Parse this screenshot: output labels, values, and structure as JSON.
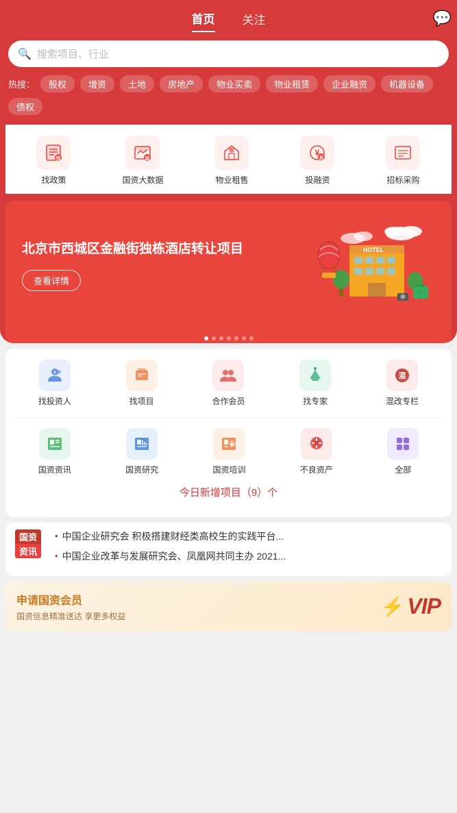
{
  "header": {
    "tab_home": "首页",
    "tab_follow": "关注",
    "message_icon": "💬"
  },
  "search": {
    "placeholder": "搜索项目、行业",
    "icon": "🔍"
  },
  "hot_search": {
    "label": "热搜：",
    "tags": [
      "股权",
      "增资",
      "土地",
      "房地产",
      "物业买卖",
      "物业租赁",
      "企业融资",
      "机器设备",
      "债权"
    ]
  },
  "quick_menu": [
    {
      "icon": "📋",
      "label": "找政策"
    },
    {
      "icon": "🏛️",
      "label": "国资大数据"
    },
    {
      "icon": "🏠",
      "label": "物业租售"
    },
    {
      "icon": "💰",
      "label": "投融资"
    },
    {
      "icon": "📑",
      "label": "招标采购"
    }
  ],
  "banner": {
    "title": "北京市西城区金融街独栋酒店转让项目",
    "btn": "查看详情",
    "dots": 7,
    "active_dot": 0
  },
  "sec_menu": [
    {
      "icon": "👤",
      "label": "找投资人",
      "color": "blue"
    },
    {
      "icon": "📁",
      "label": "找项目",
      "color": "orange"
    },
    {
      "icon": "🤝",
      "label": "合作会员",
      "color": "red"
    },
    {
      "icon": "🎓",
      "label": "找专家",
      "color": "teal"
    },
    {
      "icon": "🔖",
      "label": "混改专栏",
      "color": "crimson"
    }
  ],
  "third_menu": [
    {
      "icon": "📰",
      "label": "国资资讯",
      "color": "green"
    },
    {
      "icon": "📊",
      "label": "国资研究",
      "color": "blue2"
    },
    {
      "icon": "🎯",
      "label": "国资培训",
      "color": "orange2"
    },
    {
      "icon": "⚠️",
      "label": "不良资产",
      "color": "red2"
    },
    {
      "icon": "⚙️",
      "label": "全部",
      "color": "purple"
    }
  ],
  "today_new": {
    "text": "今日新增项目（9）个"
  },
  "news": [
    {
      "badge_top": "国资",
      "badge_bottom": "资讯",
      "items": [
        "• 中国企业研究会 积极搭建财经类高校生的实践平台...",
        "• 中国企业改革与发展研究会、凤凰网共同主办 2021..."
      ]
    }
  ],
  "vip": {
    "title": "申请国资会员",
    "subtitle": "国资信息精准送达 享更多权益",
    "lightning": "⚡",
    "vip_text": "VIP"
  }
}
